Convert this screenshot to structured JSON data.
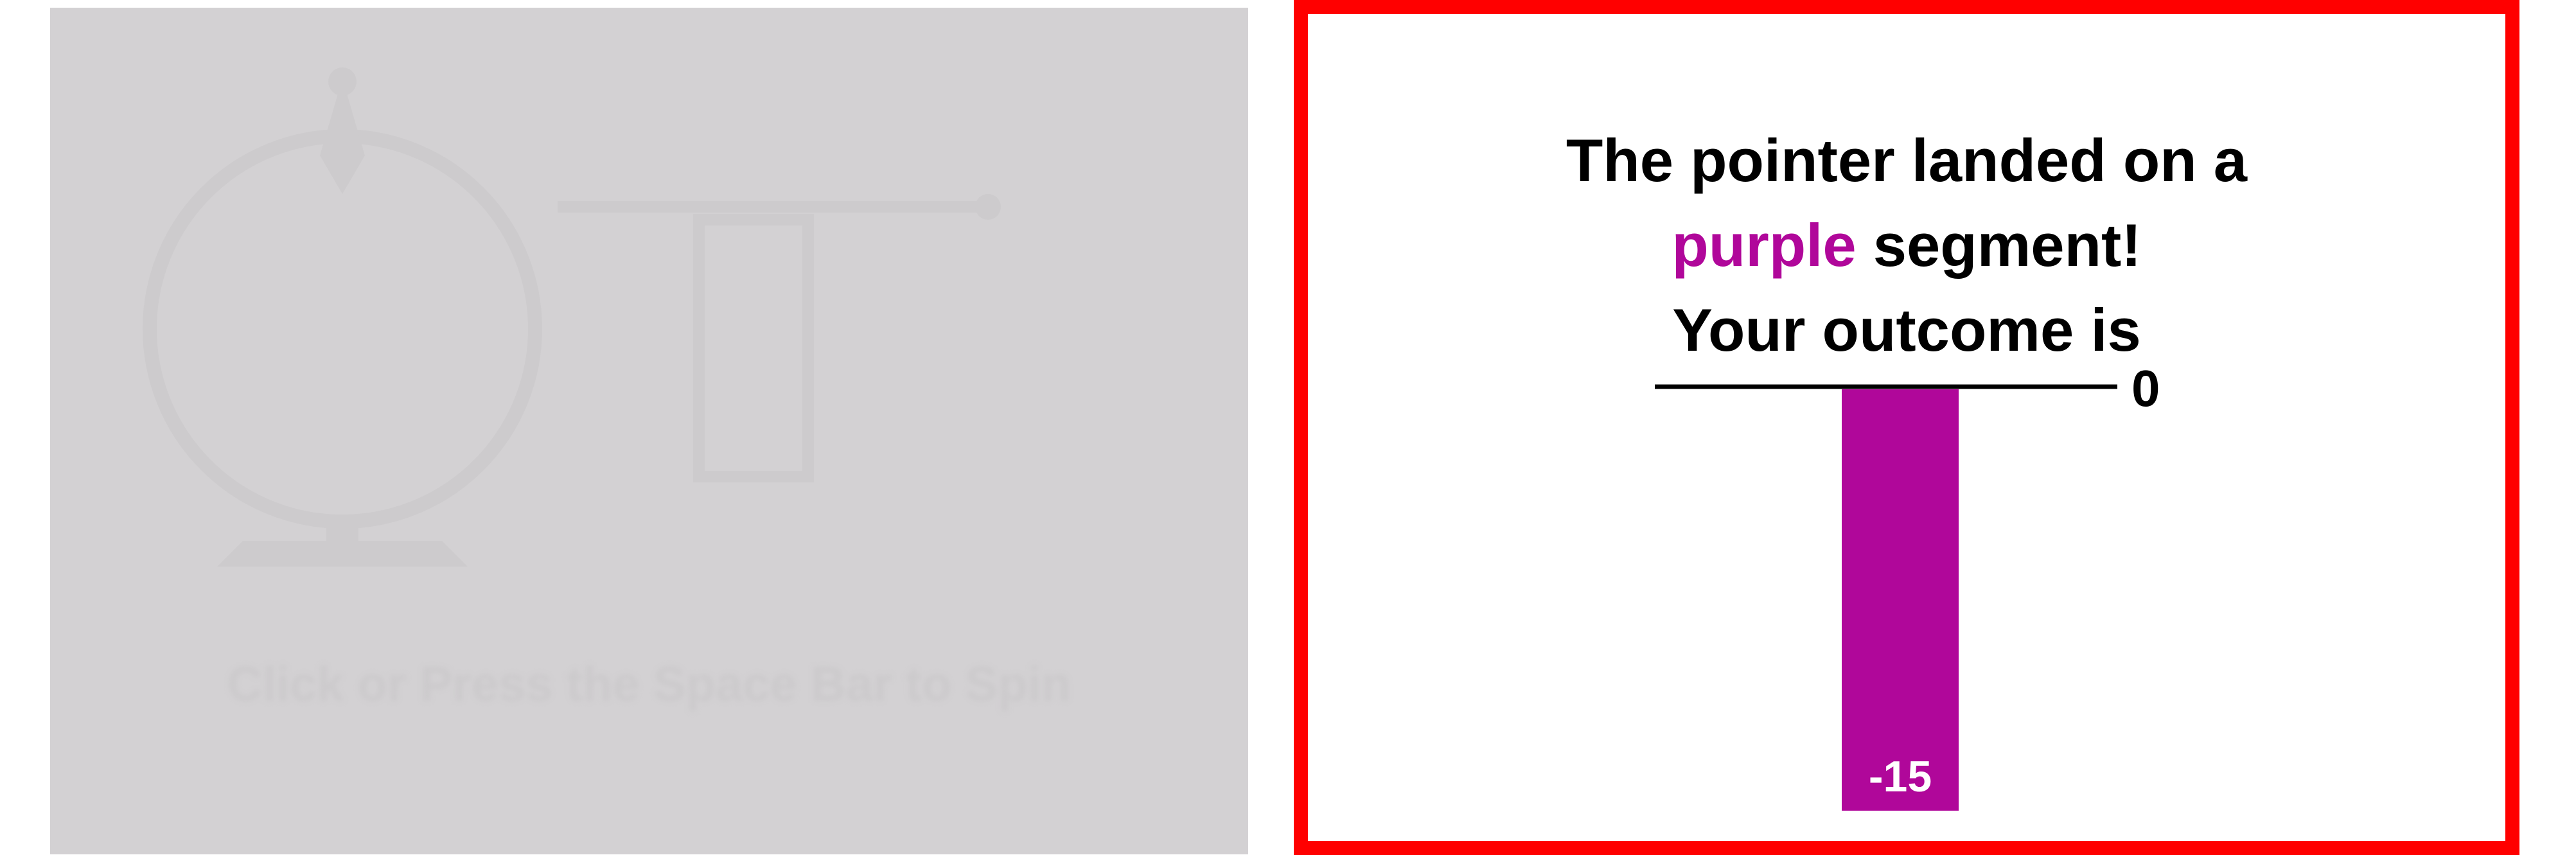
{
  "left_panel": {
    "caption": "Click or Press the Space Bar to Spin"
  },
  "result": {
    "line1": "The pointer landed on a",
    "color_word": "purple",
    "line2_rest": " segment!",
    "line3": "Your outcome is"
  },
  "colors": {
    "frame": "#ff0000",
    "segment": "#b0079a",
    "faded_bg": "#d3d1d3",
    "faded_shape": "#cfcdcf"
  },
  "chart_data": {
    "type": "bar",
    "categories": [
      ""
    ],
    "values": [
      -15
    ],
    "value_labels": [
      "-15"
    ],
    "baseline_label": "0",
    "ylim": [
      -15,
      0
    ],
    "bar_color": "#b0079a"
  }
}
